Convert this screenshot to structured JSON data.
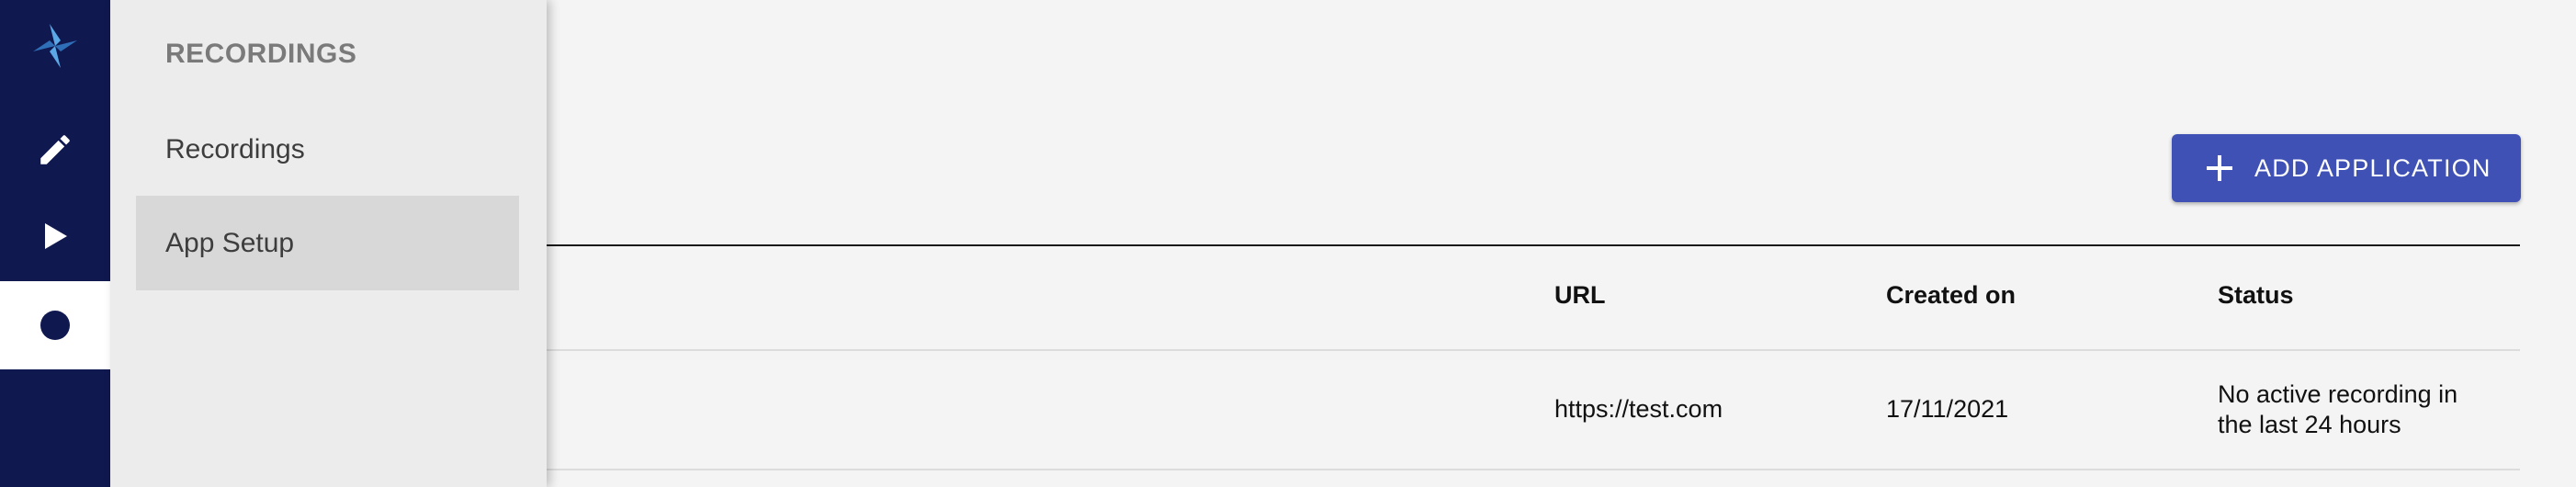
{
  "sidebar": {
    "icons": [
      "pinwheel-logo-icon",
      "pencil-icon",
      "play-icon",
      "record-dot-icon"
    ],
    "active": "record-dot-icon",
    "colors": {
      "background": "#101850",
      "logo_light": "#5aa9e6",
      "logo_dark": "#2e6fb8"
    }
  },
  "flyout": {
    "heading": "RECORDINGS",
    "items": [
      {
        "label": "Recordings"
      },
      {
        "label": "App Setup",
        "selected": true
      }
    ]
  },
  "toolbar": {
    "add_label": "ADD APPLICATION",
    "accent_color": "#3f51b5"
  },
  "table": {
    "columns": [
      "URL",
      "Created on",
      "Status"
    ],
    "rows": [
      {
        "url": "https://test.com",
        "created_on": "17/11/2021",
        "status": "No active recording in the last 24 hours"
      }
    ]
  }
}
